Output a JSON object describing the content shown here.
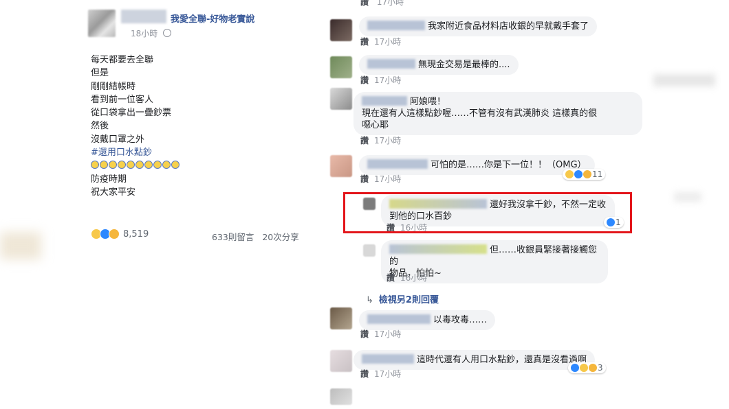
{
  "post": {
    "page_name": "我愛全聯-好物老實說",
    "time": "18小時",
    "lines": [
      "每天都要去全聯",
      "但是",
      "剛剛結帳時",
      "看到前一位客人",
      "從口袋拿出一疊鈔票",
      "然後",
      "沒戴口罩之外"
    ],
    "hashtag": "#還用口水點鈔",
    "tail_lines": [
      "防疫時期",
      "祝大家平安"
    ],
    "reaction_count": "8,519",
    "comments_count": "633則留言",
    "shares_count": "20次分享",
    "colors": {
      "link": "#385898",
      "highlight": "#e3161b"
    }
  },
  "comments": [
    {
      "text": "我家附近食品材料店收銀的早就戴手套了",
      "like": "讚",
      "time": "17小時"
    },
    {
      "text": "無現金交易是最棒的....",
      "like": "讚",
      "time": "17小時"
    },
    {
      "text_line1": "阿娘喂！",
      "text_line2": "現在還有人這樣點鈔喔……不管有沒有武漢肺炎 這樣真的很",
      "text_line3": "噁心耶",
      "like": "讚",
      "time": "17小時"
    },
    {
      "text": "可怕的是……你是下一位！！（OMG）",
      "like": "讚",
      "time": "17小時",
      "reactions": "11"
    },
    {
      "text_line1": "還好我沒拿千鈔，不然一定收",
      "text_line2": "到他的口水百鈔",
      "like": "讚",
      "time": "16小時",
      "reactions": "1"
    },
    {
      "text_line1": "但……收銀員緊接著接觸您的",
      "text_line2": "物品，怕怕~",
      "like": "讚",
      "time": "16小時"
    },
    {
      "text": "以毒攻毒……",
      "like": "讚",
      "time": "17小時"
    },
    {
      "text": "這時代還有人用口水點鈔，還真是沒看過啊",
      "like": "讚",
      "time": "17小時",
      "reactions": "3"
    }
  ],
  "view_more": "檢視另2則回覆",
  "top_meta": {
    "like": "讚",
    "time": "17小時"
  }
}
